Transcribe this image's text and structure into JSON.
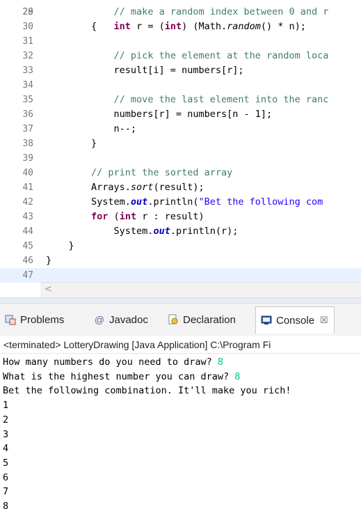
{
  "editor": {
    "top_stub": "28",
    "lines": [
      {
        "n": "29",
        "code": [
          {
            "t": "            "
          },
          {
            "t": "// make a random index between 0 and r",
            "c": "comment"
          }
        ]
      },
      {
        "n": "30",
        "code": [
          {
            "t": "            "
          },
          {
            "t": "int",
            "c": "kw"
          },
          {
            "t": " r = ("
          },
          {
            "t": "int",
            "c": "kw"
          },
          {
            "t": ") (Math."
          },
          {
            "t": "random",
            "c": "static"
          },
          {
            "t": "() * n);"
          }
        ]
      },
      {
        "n": "31",
        "code": []
      },
      {
        "n": "32",
        "code": [
          {
            "t": "            "
          },
          {
            "t": "// pick the element at the random loca",
            "c": "comment"
          }
        ]
      },
      {
        "n": "33",
        "code": [
          {
            "t": "            result[i] = numbers[r];"
          }
        ]
      },
      {
        "n": "34",
        "code": []
      },
      {
        "n": "35",
        "code": [
          {
            "t": "            "
          },
          {
            "t": "// move the last element into the ranc",
            "c": "comment"
          }
        ]
      },
      {
        "n": "36",
        "code": [
          {
            "t": "            numbers[r] = numbers[n - 1];"
          }
        ]
      },
      {
        "n": "37",
        "code": [
          {
            "t": "            n--;"
          }
        ]
      },
      {
        "n": "38",
        "code": [
          {
            "t": "        }"
          }
        ]
      },
      {
        "n": "39",
        "code": []
      },
      {
        "n": "40",
        "code": [
          {
            "t": "        "
          },
          {
            "t": "// print the sorted array",
            "c": "comment"
          }
        ]
      },
      {
        "n": "41",
        "code": [
          {
            "t": "        Arrays."
          },
          {
            "t": "sort",
            "c": "static"
          },
          {
            "t": "(result);"
          }
        ]
      },
      {
        "n": "42",
        "code": [
          {
            "t": "        System."
          },
          {
            "t": "out",
            "c": "field"
          },
          {
            "t": ".println("
          },
          {
            "t": "\"Bet the following com",
            "c": "str"
          }
        ]
      },
      {
        "n": "43",
        "code": [
          {
            "t": "        "
          },
          {
            "t": "for",
            "c": "kw"
          },
          {
            "t": " ("
          },
          {
            "t": "int",
            "c": "kw"
          },
          {
            "t": " r : result)"
          }
        ]
      },
      {
        "n": "44",
        "code": [
          {
            "t": "            System."
          },
          {
            "t": "out",
            "c": "field"
          },
          {
            "t": ".println(r);"
          }
        ]
      },
      {
        "n": "45",
        "code": [
          {
            "t": "    }"
          }
        ]
      },
      {
        "n": "46",
        "code": [
          {
            "t": "}"
          }
        ]
      },
      {
        "n": "47",
        "code": []
      }
    ],
    "current_line": "47",
    "scroll_left_arrow": "<"
  },
  "tabs": {
    "problems": "Problems",
    "javadoc": "Javadoc",
    "declaration": "Declaration",
    "console": "Console",
    "console_close": "☒"
  },
  "console": {
    "status": "<terminated> LotteryDrawing [Java Application] C:\\Program Fi",
    "lines": [
      {
        "text": "How many numbers do you need to draw? ",
        "input": "8"
      },
      {
        "text": "What is the highest number you can draw? ",
        "input": "8"
      },
      {
        "text": "Bet the following combination. It'll make you rich!",
        "input": ""
      },
      {
        "text": "1",
        "input": ""
      },
      {
        "text": "2",
        "input": ""
      },
      {
        "text": "3",
        "input": ""
      },
      {
        "text": "4",
        "input": ""
      },
      {
        "text": "5",
        "input": ""
      },
      {
        "text": "6",
        "input": ""
      },
      {
        "text": "7",
        "input": ""
      },
      {
        "text": "8",
        "input": ""
      }
    ]
  },
  "colors": {
    "comment": "#3f7f5f",
    "keyword": "#7f0055",
    "string": "#2a00ff",
    "field": "#0000c0",
    "console_input": "#00c87d",
    "current_line": "#e8f2fe"
  }
}
